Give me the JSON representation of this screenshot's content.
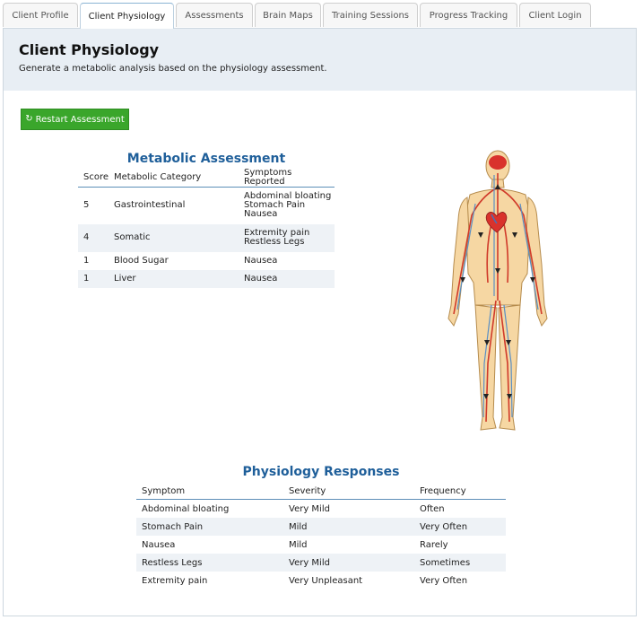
{
  "tabs": [
    {
      "label": "Client Profile"
    },
    {
      "label": "Client Physiology"
    },
    {
      "label": "Assessments"
    },
    {
      "label": "Brain Maps"
    },
    {
      "label": "Training Sessions"
    },
    {
      "label": "Progress Tracking"
    },
    {
      "label": "Client Login"
    }
  ],
  "active_tab": "Client Physiology",
  "header": {
    "title": "Client Physiology",
    "subtitle": "Generate a metabolic analysis based on the physiology assessment."
  },
  "restart_button": {
    "label": "Restart Assessment",
    "icon": "refresh-icon",
    "color": "#3aa62b"
  },
  "metabolic": {
    "title": "Metabolic Assessment",
    "columns": [
      "Score",
      "Metabolic Category",
      "Symptoms Reported"
    ],
    "rows": [
      {
        "score": "5",
        "category": "Gastrointestinal",
        "symptoms": [
          "Abdominal bloating",
          "Stomach Pain",
          "Nausea"
        ]
      },
      {
        "score": "4",
        "category": "Somatic",
        "symptoms": [
          "Extremity pain",
          "Restless Legs"
        ]
      },
      {
        "score": "1",
        "category": "Blood Sugar",
        "symptoms": [
          "Nausea"
        ]
      },
      {
        "score": "1",
        "category": "Liver",
        "symptoms": [
          "Nausea"
        ]
      }
    ]
  },
  "responses": {
    "title": "Physiology Responses",
    "columns": [
      "Symptom",
      "Severity",
      "Frequency"
    ],
    "rows": [
      {
        "symptom": "Abdominal bloating",
        "severity": "Very Mild",
        "frequency": "Often"
      },
      {
        "symptom": "Stomach Pain",
        "severity": "Mild",
        "frequency": "Very Often"
      },
      {
        "symptom": "Nausea",
        "severity": "Mild",
        "frequency": "Rarely"
      },
      {
        "symptom": "Restless Legs",
        "severity": "Very Mild",
        "frequency": "Sometimes"
      },
      {
        "symptom": "Extremity pain",
        "severity": "Very Unpleasant",
        "frequency": "Very Often"
      }
    ]
  },
  "colors": {
    "title_blue": "#1f5f9a",
    "header_band": "#e8eef4",
    "row_alt": "#eef2f6"
  }
}
